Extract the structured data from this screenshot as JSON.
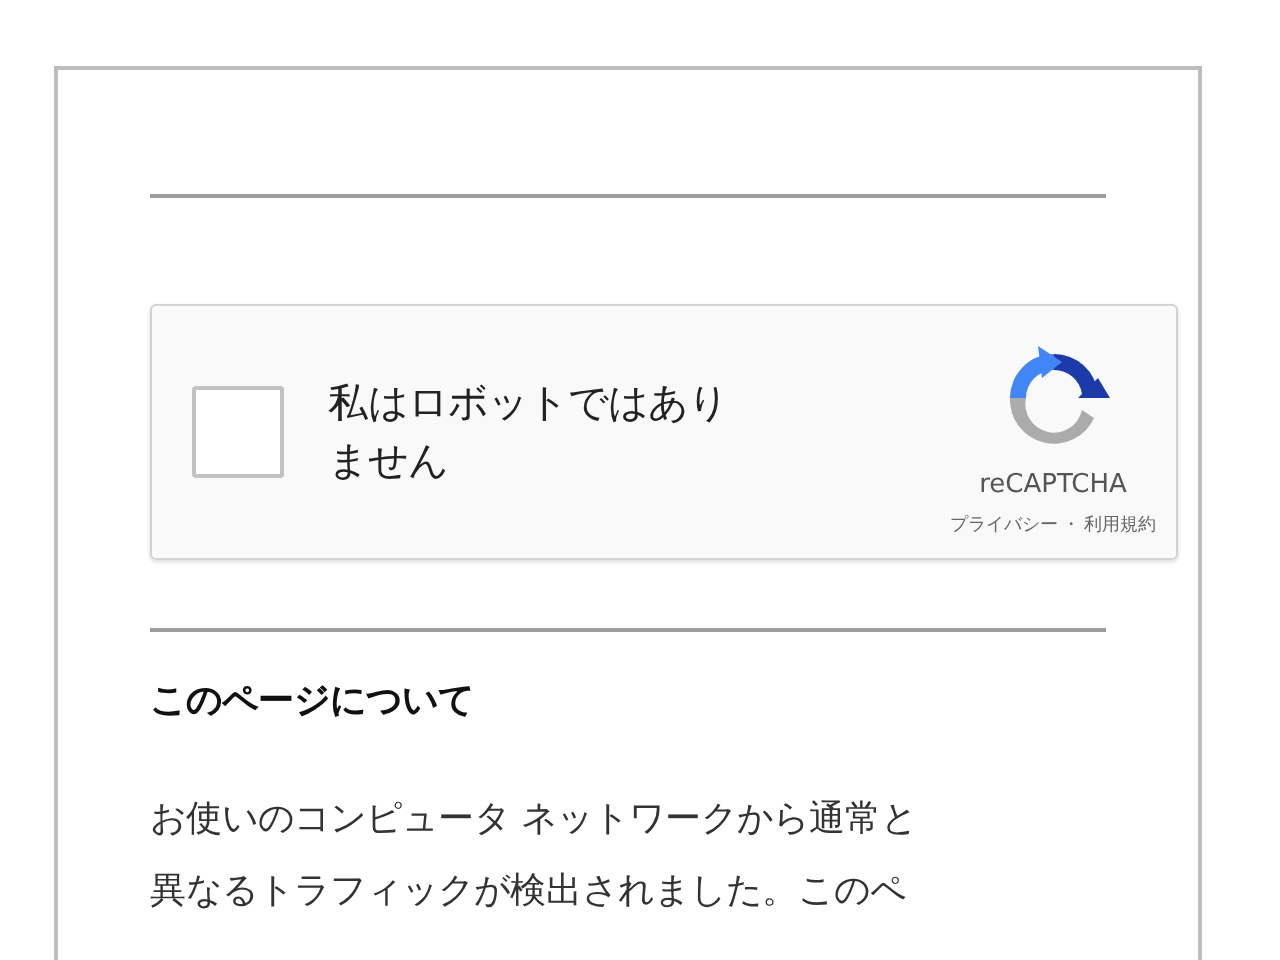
{
  "captcha": {
    "checkbox": {
      "checked": false
    },
    "label": "私はロボットではありません",
    "brand": "reCAPTCHA",
    "privacy_link": "プライバシー",
    "separator": "・",
    "terms_link": "利用規約"
  },
  "about": {
    "heading": "このページについて",
    "lines": [
      "お使いのコンピュータ ネットワークから通常と",
      "異なるトラフィックが検出されました。このペ"
    ]
  }
}
